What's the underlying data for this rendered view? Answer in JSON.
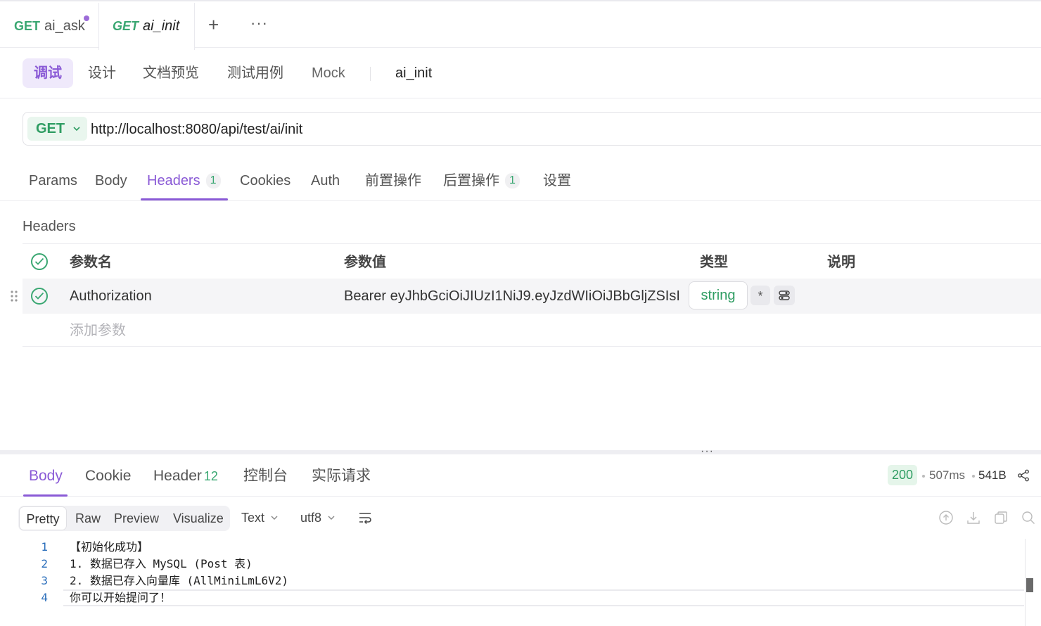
{
  "doc_tabs": [
    {
      "method": "GET",
      "name": "ai_ask",
      "unsaved": true
    },
    {
      "method": "GET",
      "name": "ai_init",
      "active": true
    }
  ],
  "tab_actions": {
    "add": "+",
    "more": "···"
  },
  "modes": [
    "调试",
    "设计",
    "文档预览",
    "测试用例",
    "Mock"
  ],
  "api_name": "ai_init",
  "request": {
    "method": "GET",
    "url": "http://localhost:8080/api/test/ai/init"
  },
  "request_tabs": [
    {
      "label": "Params"
    },
    {
      "label": "Body"
    },
    {
      "label": "Headers",
      "badge": "1",
      "active": true
    },
    {
      "label": "Cookies"
    },
    {
      "label": "Auth"
    },
    {
      "label": "前置操作"
    },
    {
      "label": "后置操作",
      "badge": "1"
    },
    {
      "label": "设置"
    }
  ],
  "headers_section": {
    "label": "Headers",
    "columns": [
      "参数名",
      "参数值",
      "类型",
      "说明"
    ],
    "rows": [
      {
        "enabled": true,
        "name": "Authorization",
        "value": "Bearer eyJhbGciOiJIUzI1NiJ9.eyJzdWIiOiJBbGljZSIsI",
        "type": "string",
        "required_mark": "*"
      }
    ],
    "add_placeholder": "添加参数"
  },
  "response": {
    "tabs": [
      {
        "label": "Body",
        "active": true
      },
      {
        "label": "Cookie"
      },
      {
        "label": "Header",
        "count": "12"
      },
      {
        "label": "控制台"
      },
      {
        "label": "实际请求"
      }
    ],
    "status": "200",
    "time": "507ms",
    "size": "541B",
    "views": [
      "Pretty",
      "Raw",
      "Preview",
      "Visualize"
    ],
    "format": "Text",
    "encoding": "utf8",
    "lines": [
      {
        "no": "1",
        "text": "【初始化成功】"
      },
      {
        "no": "2",
        "text": "1. 数据已存入 MySQL (Post 表)"
      },
      {
        "no": "3",
        "text": "2. 数据已存入向量库 (AllMiniLmL6V2)"
      },
      {
        "no": "4",
        "text": "你可以开始提问了！"
      }
    ]
  },
  "colors": {
    "accent": "#8a5ad6",
    "method_green": "#2f9d63",
    "status_bg": "#e5f5ea"
  },
  "icons": [
    "plus-icon",
    "more-icon",
    "chevron-down-icon",
    "check-circle-icon",
    "drag-handle-icon",
    "settings-toggle-icon",
    "share-icon",
    "wrap-icon",
    "upload-icon",
    "download-icon",
    "copy-icon",
    "search-icon"
  ]
}
